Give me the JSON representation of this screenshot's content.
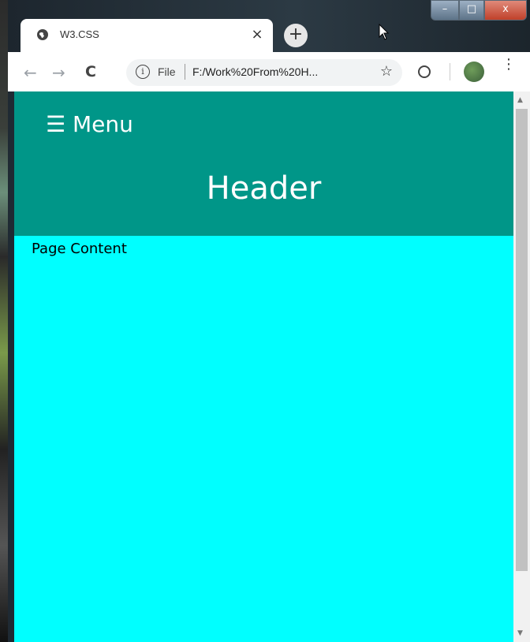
{
  "browser": {
    "tab_title": "W3.CSS",
    "tab_close": "×",
    "new_tab": "+",
    "address_scheme": "File",
    "address_url": "F:/Work%20From%20H...",
    "bookmark_star": "☆",
    "menu_dots": "⋮"
  },
  "window_controls": {
    "minimize": "–",
    "maximize": "□",
    "close": "x"
  },
  "page": {
    "menu_label": "☰ Menu",
    "header": "Header",
    "content": "Page Content"
  },
  "colors": {
    "teal": "#009688",
    "cyan": "#00ffff"
  },
  "icons": [
    "globe-icon",
    "close-icon",
    "plus-icon",
    "back-icon",
    "forward-icon",
    "reload-icon",
    "info-icon",
    "star-icon",
    "extension-icon",
    "avatar",
    "kebab-icon"
  ]
}
